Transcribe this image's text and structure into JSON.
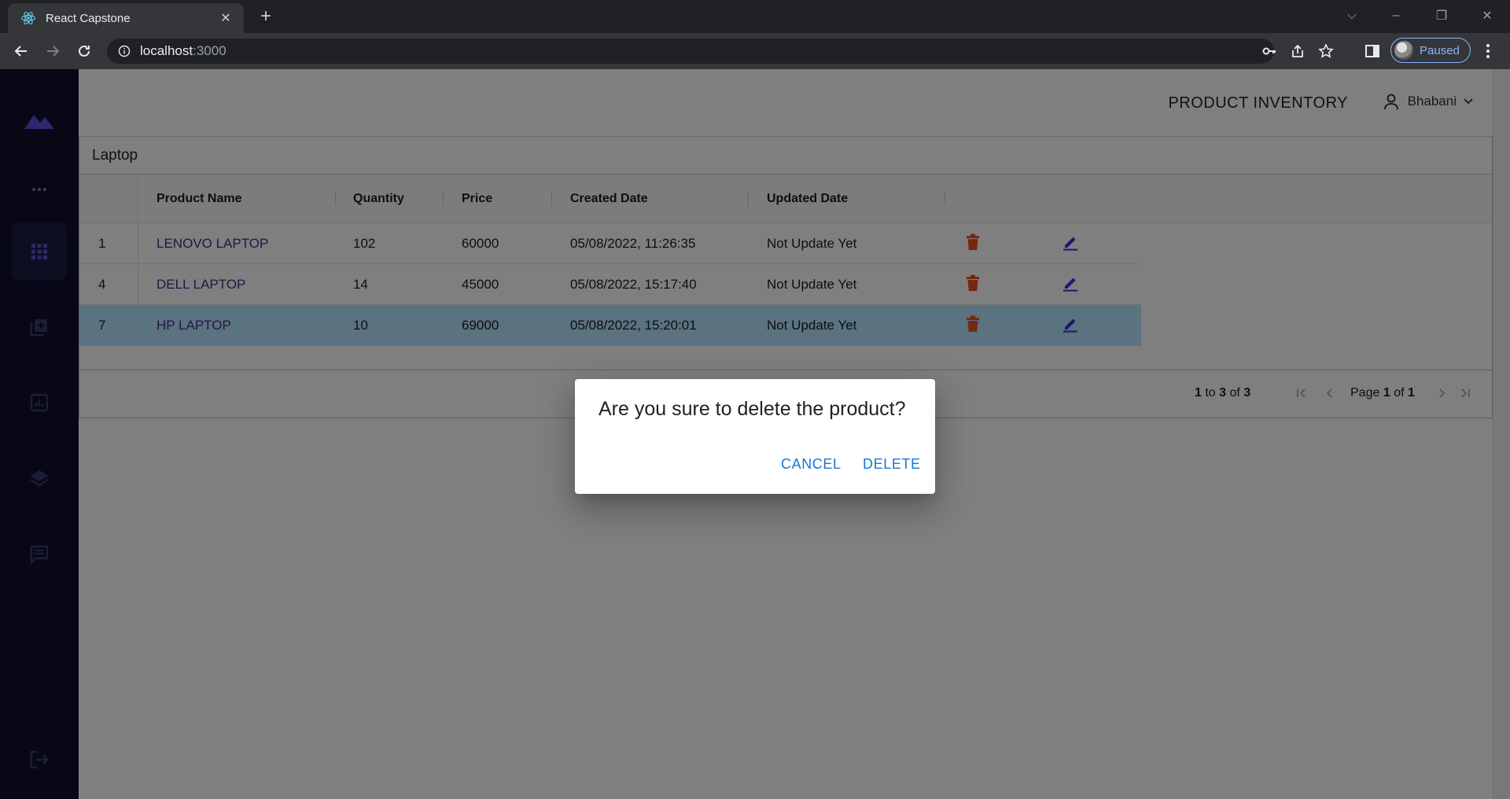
{
  "browser": {
    "tab_title": "React Capstone",
    "url_host": "localhost",
    "url_port": ":3000",
    "profile_status": "Paused"
  },
  "app": {
    "title": "PRODUCT INVENTORY",
    "user_name": "Bhabani",
    "sidebar_icons": [
      "logo-icon",
      "more-icon",
      "grid-icon",
      "add-box-icon",
      "chart-icon",
      "layers-icon",
      "chat-icon",
      "logout-icon"
    ]
  },
  "grid": {
    "group_label": "Laptop",
    "columns": [
      "Product Name",
      "Quantity",
      "Price",
      "Created Date",
      "Updated Date"
    ],
    "rows": [
      {
        "id": "1",
        "name": "LENOVO LAPTOP",
        "quantity": "102",
        "price": "60000",
        "created": "05/08/2022, 11:26:35",
        "updated": "Not Update Yet"
      },
      {
        "id": "4",
        "name": "DELL LAPTOP",
        "quantity": "14",
        "price": "45000",
        "created": "05/08/2022, 15:17:40",
        "updated": "Not Update Yet"
      },
      {
        "id": "7",
        "name": "HP LAPTOP",
        "quantity": "10",
        "price": "69000",
        "created": "05/08/2022, 15:20:01",
        "updated": "Not Update Yet"
      }
    ],
    "selected_row_index": 2,
    "pager": {
      "from": "1",
      "to_word": "to",
      "to": "3",
      "of_word": "of",
      "total": "3",
      "page_word": "Page",
      "page": "1",
      "pages_of_word": "of",
      "pages": "1"
    }
  },
  "dialog": {
    "message": "Are you sure to delete the product?",
    "cancel_label": "CANCEL",
    "delete_label": "DELETE"
  },
  "colors": {
    "sidebar_bg": "#0f0f2d",
    "accent": "#5b4fd6",
    "delete_icon": "#e8501e",
    "edit_icon": "#3d2fd9",
    "dialog_button": "#1976d2",
    "selected_row": "#b7e4ff"
  }
}
